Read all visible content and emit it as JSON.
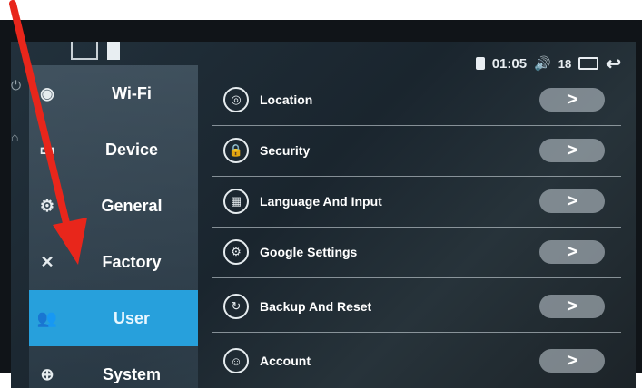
{
  "status_bar": {
    "time": "01:05",
    "volume_icon": "speaker-icon",
    "volume_level": "18",
    "recents_icon": "window-icon",
    "back_icon": "back-arrow-icon"
  },
  "sidebar": {
    "items": [
      {
        "label": "Wi-Fi",
        "icon": "wifi-icon",
        "active": false
      },
      {
        "label": "Device",
        "icon": "device-icon",
        "active": false
      },
      {
        "label": "General",
        "icon": "gear-icon",
        "active": false
      },
      {
        "label": "Factory",
        "icon": "tools-icon",
        "active": false
      },
      {
        "label": "User",
        "icon": "user-icon",
        "active": true
      },
      {
        "label": "System",
        "icon": "globe-icon",
        "active": false
      }
    ]
  },
  "settings": {
    "rows": [
      {
        "label": "Location",
        "icon": "location-icon"
      },
      {
        "label": "Security",
        "icon": "lock-icon"
      },
      {
        "label": "Language And Input",
        "icon": "keyboard-icon"
      },
      {
        "label": "Google Settings",
        "icon": "google-settings-icon"
      },
      {
        "label": "Backup And Reset",
        "icon": "backup-icon"
      },
      {
        "label": "Account",
        "icon": "account-icon"
      }
    ],
    "chevron": ">"
  },
  "annotation": {
    "arrow_color": "#e8261b"
  },
  "colors": {
    "active_item": "#27a0dc"
  }
}
